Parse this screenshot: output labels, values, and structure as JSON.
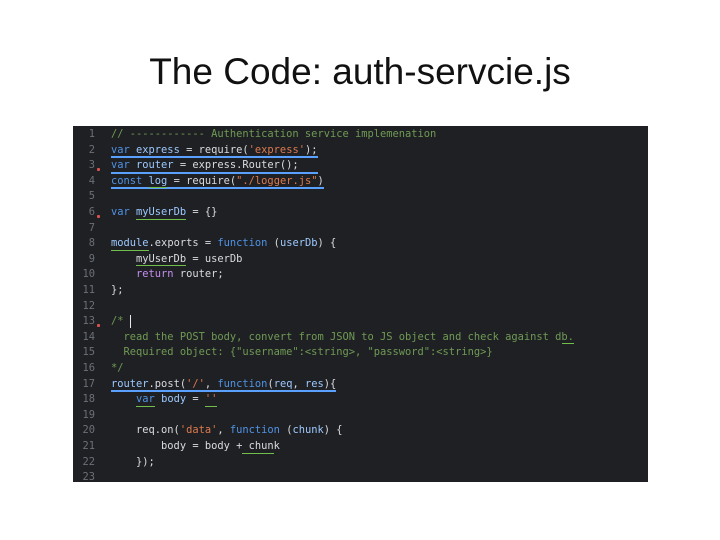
{
  "slide": {
    "title": "The Code: auth-servcie.js"
  },
  "editor": {
    "lines": [
      {
        "number": "1",
        "tokens": [
          {
            "text": "// ------------ Authentication service implemenation",
            "kind": "comment"
          }
        ]
      },
      {
        "number": "2",
        "tokens": [
          {
            "text": "var ",
            "kind": "keyword"
          },
          {
            "text": "express",
            "kind": "var"
          },
          {
            "text": " = require(",
            "kind": "ident"
          },
          {
            "text": "'express'",
            "kind": "string"
          },
          {
            "text": ");",
            "kind": "punct"
          }
        ]
      },
      {
        "number": "3",
        "tokens": [
          {
            "text": "var ",
            "kind": "keyword"
          },
          {
            "text": "router",
            "kind": "var"
          },
          {
            "text": " = express.Router();",
            "kind": "ident"
          }
        ]
      },
      {
        "number": "4",
        "tokens": [
          {
            "text": "const ",
            "kind": "keyword"
          },
          {
            "text": "log",
            "kind": "var"
          },
          {
            "text": " = require(",
            "kind": "ident"
          },
          {
            "text": "\"./logger.js\"",
            "kind": "string"
          },
          {
            "text": ")",
            "kind": "punct"
          }
        ]
      },
      {
        "number": "5",
        "tokens": []
      },
      {
        "number": "6",
        "tokens": [
          {
            "text": "var ",
            "kind": "keyword"
          },
          {
            "text": "myUserDb",
            "kind": "var"
          },
          {
            "text": " = {}",
            "kind": "ident"
          }
        ]
      },
      {
        "number": "7",
        "tokens": []
      },
      {
        "number": "8",
        "tokens": [
          {
            "text": "module",
            "kind": "var"
          },
          {
            "text": ".exports = ",
            "kind": "ident"
          },
          {
            "text": "function",
            "kind": "keyword"
          },
          {
            "text": " (",
            "kind": "punct"
          },
          {
            "text": "userDb",
            "kind": "var"
          },
          {
            "text": ") {",
            "kind": "punct"
          }
        ]
      },
      {
        "number": "9",
        "tokens": [
          {
            "text": "    myUserDb = userDb",
            "kind": "ident"
          }
        ]
      },
      {
        "number": "10",
        "tokens": [
          {
            "text": "    ",
            "kind": "ident"
          },
          {
            "text": "return",
            "kind": "ret"
          },
          {
            "text": " router;",
            "kind": "ident"
          }
        ]
      },
      {
        "number": "11",
        "tokens": [
          {
            "text": "};",
            "kind": "punct"
          }
        ]
      },
      {
        "number": "12",
        "tokens": []
      },
      {
        "number": "13",
        "tokens": [
          {
            "text": "/*",
            "kind": "comment"
          }
        ]
      },
      {
        "number": "14",
        "tokens": [
          {
            "text": "  read the POST body, convert from JSON to JS object and check against db.",
            "kind": "comment"
          }
        ]
      },
      {
        "number": "15",
        "tokens": [
          {
            "text": "  Required object: {\"username\":<string>, \"password\":<string>}",
            "kind": "comment"
          }
        ]
      },
      {
        "number": "16",
        "tokens": [
          {
            "text": "*/",
            "kind": "comment"
          }
        ]
      },
      {
        "number": "17",
        "tokens": [
          {
            "text": "router",
            "kind": "var"
          },
          {
            "text": ".post(",
            "kind": "ident"
          },
          {
            "text": "'/'",
            "kind": "string"
          },
          {
            "text": ", ",
            "kind": "punct"
          },
          {
            "text": "function",
            "kind": "keyword"
          },
          {
            "text": "(",
            "kind": "punct"
          },
          {
            "text": "req",
            "kind": "var"
          },
          {
            "text": ", ",
            "kind": "punct"
          },
          {
            "text": "res",
            "kind": "var"
          },
          {
            "text": "){",
            "kind": "punct"
          }
        ]
      },
      {
        "number": "18",
        "tokens": [
          {
            "text": "    ",
            "kind": "ident"
          },
          {
            "text": "var ",
            "kind": "keyword"
          },
          {
            "text": "body",
            "kind": "var"
          },
          {
            "text": " = ",
            "kind": "ident"
          },
          {
            "text": "''",
            "kind": "string"
          }
        ]
      },
      {
        "number": "19",
        "tokens": []
      },
      {
        "number": "20",
        "tokens": [
          {
            "text": "    req.on(",
            "kind": "ident"
          },
          {
            "text": "'data'",
            "kind": "string"
          },
          {
            "text": ", ",
            "kind": "punct"
          },
          {
            "text": "function",
            "kind": "keyword"
          },
          {
            "text": " (",
            "kind": "punct"
          },
          {
            "text": "chunk",
            "kind": "var"
          },
          {
            "text": ") {",
            "kind": "punct"
          }
        ]
      },
      {
        "number": "21",
        "tokens": [
          {
            "text": "        body = body + chunk",
            "kind": "ident"
          }
        ]
      },
      {
        "number": "22",
        "tokens": [
          {
            "text": "    });",
            "kind": "punct"
          }
        ]
      },
      {
        "number": "23",
        "tokens": []
      }
    ]
  }
}
